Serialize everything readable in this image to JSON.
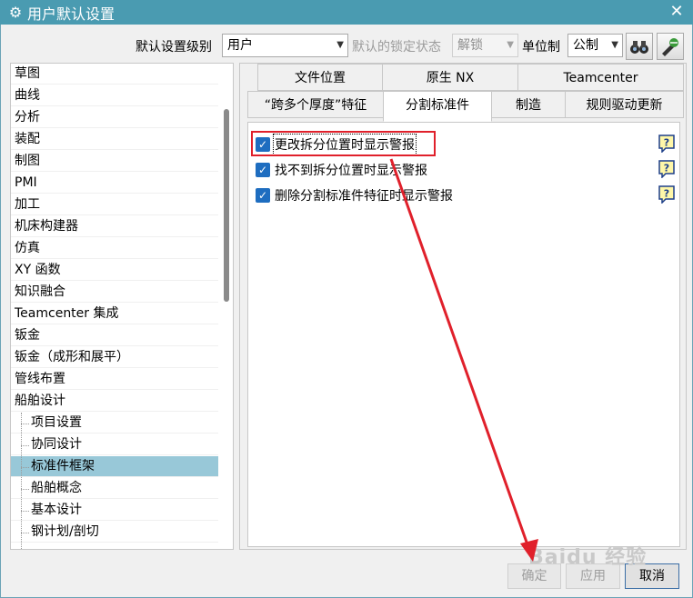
{
  "window": {
    "title": "用户默认设置"
  },
  "toolbar": {
    "level_label": "默认设置级别",
    "level_value": "用户",
    "lock_label": "默认的锁定状态",
    "lock_value": "解锁",
    "unit_label": "单位制",
    "unit_value": "公制"
  },
  "tree": {
    "items": [
      "草图",
      "曲线",
      "分析",
      "装配",
      "制图",
      "PMI",
      "加工",
      "机床构建器",
      "仿真",
      "XY 函数",
      "知识融合",
      "Teamcenter 集成",
      "钣金",
      "钣金（成形和展平）",
      "管线布置",
      "船舶设计"
    ],
    "children": [
      "项目设置",
      "协同设计",
      "标准件框架",
      "船舶概念",
      "基本设计",
      "钢计划/剖切"
    ],
    "selected_child": "标准件框架"
  },
  "tabs": {
    "row1": [
      "文件位置",
      "原生 NX",
      "Teamcenter"
    ],
    "row2": [
      "“跨多个厚度”特征",
      "分割标准件",
      "制造",
      "规则驱动更新"
    ],
    "active": "分割标准件"
  },
  "options": [
    {
      "label": "更改拆分位置时显示警报",
      "checked": true
    },
    {
      "label": "找不到拆分位置时显示警报",
      "checked": true
    },
    {
      "label": "删除分割标准件特征时显示警报",
      "checked": true
    }
  ],
  "buttons": {
    "ok": "确定",
    "apply": "应用",
    "cancel": "取消"
  },
  "watermark": "Baidu 经验",
  "colors": {
    "titlebar": "#4a9bb1",
    "selection": "#98c8d8",
    "checkbox": "#1e6dc0",
    "annotation": "#e0202b"
  }
}
